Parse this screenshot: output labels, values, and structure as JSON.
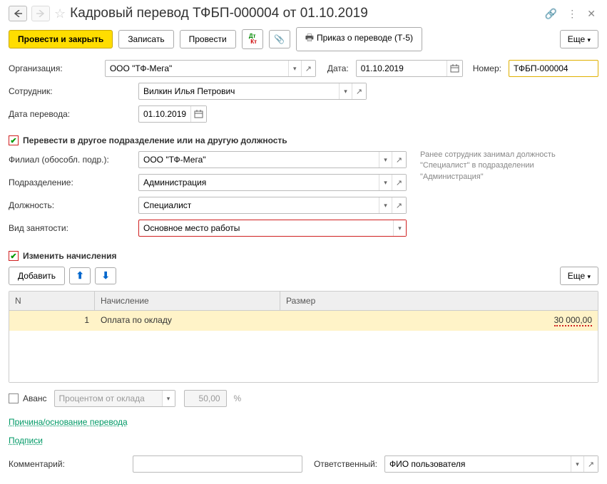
{
  "header": {
    "title": "Кадровый перевод ТФБП-000004 от 01.10.2019"
  },
  "toolbar": {
    "post_close": "Провести и закрыть",
    "save": "Записать",
    "post": "Провести",
    "print_order": "Приказ о переводе (Т-5)",
    "more": "Еще"
  },
  "fields": {
    "org_label": "Организация:",
    "org_value": "ООО \"ТФ-Мега\"",
    "date_label": "Дата:",
    "date_value": "01.10.2019",
    "number_label": "Номер:",
    "number_value": "ТФБП-000004",
    "employee_label": "Сотрудник:",
    "employee_value": "Вилкин Илья Петрович",
    "transfer_date_label": "Дата перевода:",
    "transfer_date_value": "01.10.2019",
    "transfer_checkbox": "Перевести в другое подразделение или на другую должность",
    "prev_info": "Ранее сотрудник занимал должность \"Специалист\" в подразделении \"Администрация\"",
    "branch_label": "Филиал (обособл. подр.):",
    "branch_value": "ООО \"ТФ-Мега\"",
    "dept_label": "Подразделение:",
    "dept_value": "Администрация",
    "position_label": "Должность:",
    "position_value": "Специалист",
    "emp_type_label": "Вид занятости:",
    "emp_type_value": "Основное место работы",
    "change_accruals": "Изменить начисления",
    "add_btn": "Добавить",
    "advance_label": "Аванс",
    "advance_type": "Процентом от оклада",
    "advance_value": "50,00",
    "advance_pct": "%",
    "reason_link": "Причина/основание перевода",
    "signatures_link": "Подписи",
    "comment_label": "Комментарий:",
    "responsible_label": "Ответственный:",
    "responsible_value": "ФИО пользователя"
  },
  "table": {
    "col_n": "N",
    "col_name": "Начисление",
    "col_size": "Размер",
    "rows": [
      {
        "n": "1",
        "name": "Оплата по окладу",
        "size": "30 000,00"
      }
    ]
  }
}
